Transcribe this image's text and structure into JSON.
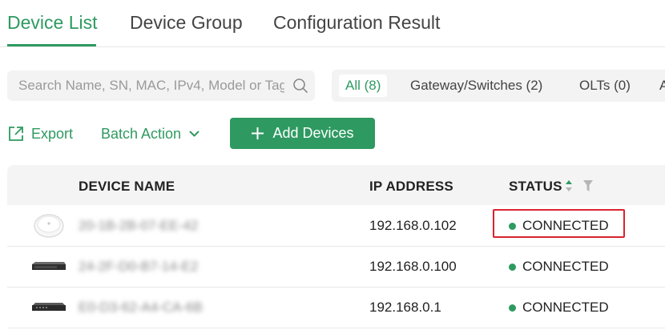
{
  "tabs": [
    {
      "label": "Device List",
      "active": true
    },
    {
      "label": "Device Group",
      "active": false
    },
    {
      "label": "Configuration Result",
      "active": false
    }
  ],
  "search": {
    "placeholder": "Search Name, SN, MAC, IPv4, Model or Tag"
  },
  "filters": [
    {
      "label": "All (8)",
      "active": true
    },
    {
      "label": "Gateway/Switches (2)",
      "active": false
    },
    {
      "label": "OLTs (0)",
      "active": false
    },
    {
      "label": "A",
      "active": false
    }
  ],
  "actions": {
    "export_label": "Export",
    "batch_label": "Batch Action",
    "add_label": "Add Devices"
  },
  "table": {
    "columns": {
      "name": "DEVICE NAME",
      "ip": "IP ADDRESS",
      "status": "STATUS"
    },
    "rows": [
      {
        "icon": "access-point-icon",
        "name": "20-1B-2B-07-EE-42",
        "ip": "192.168.0.102",
        "status": "CONNECTED",
        "highlighted": true
      },
      {
        "icon": "switch-icon",
        "name": "24-2F-D0-B7-14-E2",
        "ip": "192.168.0.100",
        "status": "CONNECTED",
        "highlighted": false
      },
      {
        "icon": "router-icon",
        "name": "E0-D3-62-A4-CA-6B",
        "ip": "192.168.0.1",
        "status": "CONNECTED",
        "highlighted": false
      }
    ]
  },
  "colors": {
    "accent": "#2e9a61",
    "highlight": "#d9232e"
  }
}
